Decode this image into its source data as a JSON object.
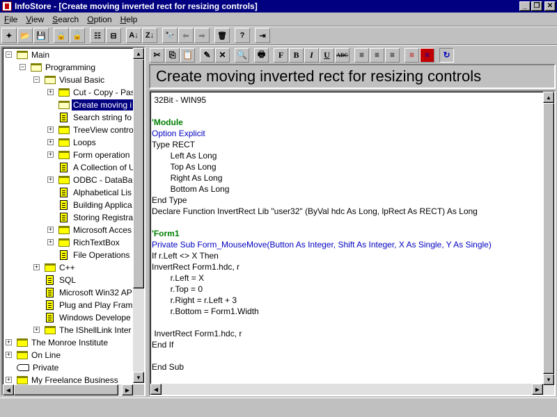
{
  "window": {
    "title": "InfoStore - [Create moving inverted rect for resizing controls]",
    "min_label": "_",
    "restore_label": "❐",
    "close_label": "✕"
  },
  "menu": [
    {
      "label": "File",
      "key": "F",
      "rest": "ile"
    },
    {
      "label": "View",
      "key": "V",
      "rest": "iew"
    },
    {
      "label": "Search",
      "key": "S",
      "rest": "earch"
    },
    {
      "label": "Option",
      "key": "O",
      "rest": "ption"
    },
    {
      "label": "Help",
      "key": "H",
      "rest": "elp"
    }
  ],
  "toolbar": [
    {
      "name": "new-icon",
      "glyph": "✦"
    },
    {
      "name": "open-folder-icon",
      "glyph": "📂"
    },
    {
      "name": "save-icon",
      "glyph": "💾"
    },
    {
      "name": "lock-icon",
      "glyph": "🔒"
    },
    {
      "name": "unlock-icon",
      "glyph": "🔓"
    },
    {
      "name": "tree-view-icon",
      "glyph": "☷"
    },
    {
      "name": "collapse-icon",
      "glyph": "⊟"
    },
    {
      "name": "sort-ascending-icon",
      "glyph": "A↓"
    },
    {
      "name": "sort-descending-icon",
      "glyph": "Z↓"
    },
    {
      "name": "find-icon",
      "glyph": "🔭"
    },
    {
      "name": "back-arrow-icon",
      "glyph": "⬅"
    },
    {
      "name": "forward-arrow-icon",
      "glyph": "➡"
    },
    {
      "name": "delete-icon",
      "glyph": "🗑"
    },
    {
      "name": "help-icon",
      "glyph": "?"
    },
    {
      "name": "exit-icon",
      "glyph": "⇥"
    }
  ],
  "tree": {
    "items": [
      {
        "label": "Main",
        "icon": "folder-open"
      },
      {
        "label": "Programming",
        "icon": "folder-open"
      },
      {
        "label": "Visual Basic",
        "icon": "folder-open"
      },
      {
        "label": "Cut - Copy - Pas",
        "icon": "folder"
      },
      {
        "label": "Create moving i",
        "icon": "folder-open"
      },
      {
        "label": "Search string fo",
        "icon": "doc"
      },
      {
        "label": "TreeView contro",
        "icon": "folder"
      },
      {
        "label": "Loops",
        "icon": "folder"
      },
      {
        "label": "Form operation",
        "icon": "folder"
      },
      {
        "label": "A Collection of U",
        "icon": "doc"
      },
      {
        "label": "ODBC - DataBa",
        "icon": "folder"
      },
      {
        "label": "Alphabetical Lis",
        "icon": "doc"
      },
      {
        "label": "Building Applica",
        "icon": "doc"
      },
      {
        "label": "Storing Registra",
        "icon": "doc"
      },
      {
        "label": "Microsoft Acces",
        "icon": "folder"
      },
      {
        "label": "RichTextBox",
        "icon": "folder"
      },
      {
        "label": "File Operations",
        "icon": "doc"
      },
      {
        "label": "C++",
        "icon": "folder"
      },
      {
        "label": "SQL",
        "icon": "doc"
      },
      {
        "label": "Microsoft Win32 AP",
        "icon": "doc"
      },
      {
        "label": "Plug and Play Fram",
        "icon": "doc"
      },
      {
        "label": "Windows Develope",
        "icon": "doc"
      },
      {
        "label": "The IShellLink Inter",
        "icon": "folder"
      },
      {
        "label": "The Monroe Institute",
        "icon": "folder"
      },
      {
        "label": "On Line",
        "icon": "folder"
      },
      {
        "label": "Private",
        "icon": "hand"
      },
      {
        "label": "My Freelance Business",
        "icon": "folder"
      }
    ]
  },
  "editor_toolbar": [
    {
      "name": "cut-icon",
      "glyph": "✂"
    },
    {
      "name": "copy-icon",
      "glyph": "⎘"
    },
    {
      "name": "paste-icon",
      "glyph": "📋"
    },
    {
      "name": "edit-icon",
      "glyph": "✎"
    },
    {
      "name": "delete-x-icon",
      "glyph": "✕"
    },
    {
      "name": "find-text-icon",
      "glyph": "🔍"
    },
    {
      "name": "print-icon",
      "glyph": "🖶"
    },
    {
      "name": "font-icon",
      "glyph": "F"
    },
    {
      "name": "bold-icon",
      "glyph": "B"
    },
    {
      "name": "italic-icon",
      "glyph": "I"
    },
    {
      "name": "underline-icon",
      "glyph": "U"
    },
    {
      "name": "strikethrough-icon",
      "glyph": "ABC"
    },
    {
      "name": "align-left-icon",
      "glyph": "≡"
    },
    {
      "name": "align-center-icon",
      "glyph": "≡"
    },
    {
      "name": "align-right-icon",
      "glyph": "≡"
    },
    {
      "name": "color-icon",
      "glyph": "≡"
    },
    {
      "name": "background-color-icon",
      "glyph": "≡"
    },
    {
      "name": "refresh-icon",
      "glyph": "↻"
    }
  ],
  "document": {
    "title": "Create moving inverted rect for resizing controls",
    "lines": [
      {
        "text": " 32Bit - WIN95",
        "style": "normal"
      },
      {
        "text": "",
        "style": "normal"
      },
      {
        "text": "'Module",
        "style": "green"
      },
      {
        "text": "Option Explicit",
        "style": "blue"
      },
      {
        "text": "Type RECT",
        "style": "normal"
      },
      {
        "text": "        Left As Long",
        "style": "normal"
      },
      {
        "text": "        Top As Long",
        "style": "normal"
      },
      {
        "text": "        Right As Long",
        "style": "normal"
      },
      {
        "text": "        Bottom As Long",
        "style": "normal"
      },
      {
        "text": "End Type",
        "style": "normal"
      },
      {
        "text": "Declare Function InvertRect Lib \"user32\" (ByVal hdc As Long, lpRect As RECT) As Long",
        "style": "normal"
      },
      {
        "text": "",
        "style": "normal"
      },
      {
        "text": "'Form1",
        "style": "green"
      },
      {
        "text": "Private Sub Form_MouseMove(Button As Integer, Shift As Integer, X As Single, Y As Single)",
        "style": "blue"
      },
      {
        "text": "If r.Left <> X Then",
        "style": "normal"
      },
      {
        "text": "InvertRect Form1.hdc, r",
        "style": "normal"
      },
      {
        "text": "        r.Left = X",
        "style": "normal"
      },
      {
        "text": "        r.Top = 0",
        "style": "normal"
      },
      {
        "text": "        r.Right = r.Left + 3",
        "style": "normal"
      },
      {
        "text": "        r.Bottom = Form1.Width",
        "style": "normal"
      },
      {
        "text": "",
        "style": "normal"
      },
      {
        "text": " InvertRect Form1.hdc, r",
        "style": "normal"
      },
      {
        "text": "End If",
        "style": "normal"
      },
      {
        "text": "",
        "style": "normal"
      },
      {
        "text": "End Sub",
        "style": "normal"
      }
    ]
  },
  "colors": {
    "titlebar": "#000080",
    "comment": "#008000",
    "keyword": "#0000c0",
    "selection": "#000080"
  }
}
